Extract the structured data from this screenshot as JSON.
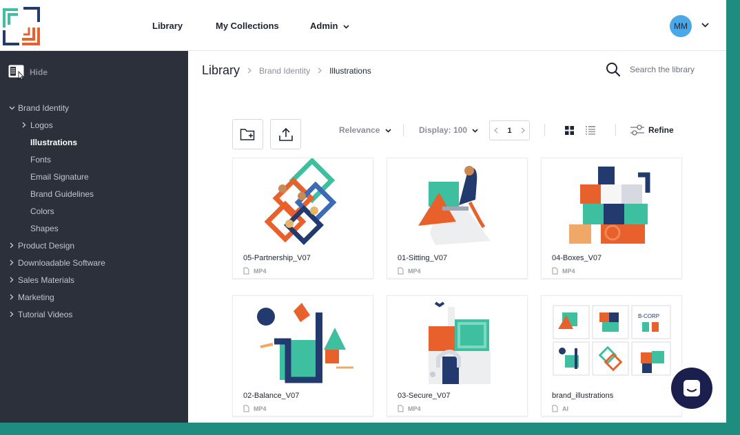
{
  "header": {
    "nav": {
      "library": "Library",
      "my_collections": "My Collections",
      "admin": "Admin"
    },
    "user_initials": "MM"
  },
  "sidebar": {
    "hide_label": "Hide",
    "tree": [
      {
        "label": "Brand Identity",
        "level": 0,
        "expanded": true
      },
      {
        "label": "Logos",
        "level": 1,
        "expanded": false
      },
      {
        "label": "Illustrations",
        "level": 2,
        "active": true
      },
      {
        "label": "Fonts",
        "level": 2
      },
      {
        "label": "Email Signature",
        "level": 2
      },
      {
        "label": "Brand Guidelines",
        "level": 2
      },
      {
        "label": "Colors",
        "level": 2
      },
      {
        "label": "Shapes",
        "level": 2
      },
      {
        "label": "Product Design",
        "level": 0
      },
      {
        "label": "Downloadable Software",
        "level": 0
      },
      {
        "label": "Sales Materials",
        "level": 0
      },
      {
        "label": "Marketing",
        "level": 0
      },
      {
        "label": "Tutorial Videos",
        "level": 0
      }
    ]
  },
  "breadcrumb": {
    "root": "Library",
    "parent": "Brand Identity",
    "current": "Illustrations"
  },
  "search": {
    "placeholder": "Search the library"
  },
  "toolbar": {
    "sort_label": "Relevance",
    "display_label": "Display: 100",
    "page": "1",
    "refine_label": "Refine"
  },
  "assets": [
    {
      "name": "05-Partnership_V07",
      "type": "MP4"
    },
    {
      "name": "01-Sitting_V07",
      "type": "MP4"
    },
    {
      "name": "04-Boxes_V07",
      "type": "MP4"
    },
    {
      "name": "02-Balance_V07",
      "type": "MP4"
    },
    {
      "name": "03-Secure_V07",
      "type": "MP4"
    },
    {
      "name": "brand_illustrations",
      "type": "AI"
    }
  ],
  "thumb_text": {
    "bcorp": "B-CORP"
  },
  "colors": {
    "sidebar_bg": "#2c303a",
    "accent_teal": "#3dbfa0",
    "accent_orange": "#e8602c",
    "navy": "#233a6e",
    "avatar": "#4aa7e8"
  }
}
